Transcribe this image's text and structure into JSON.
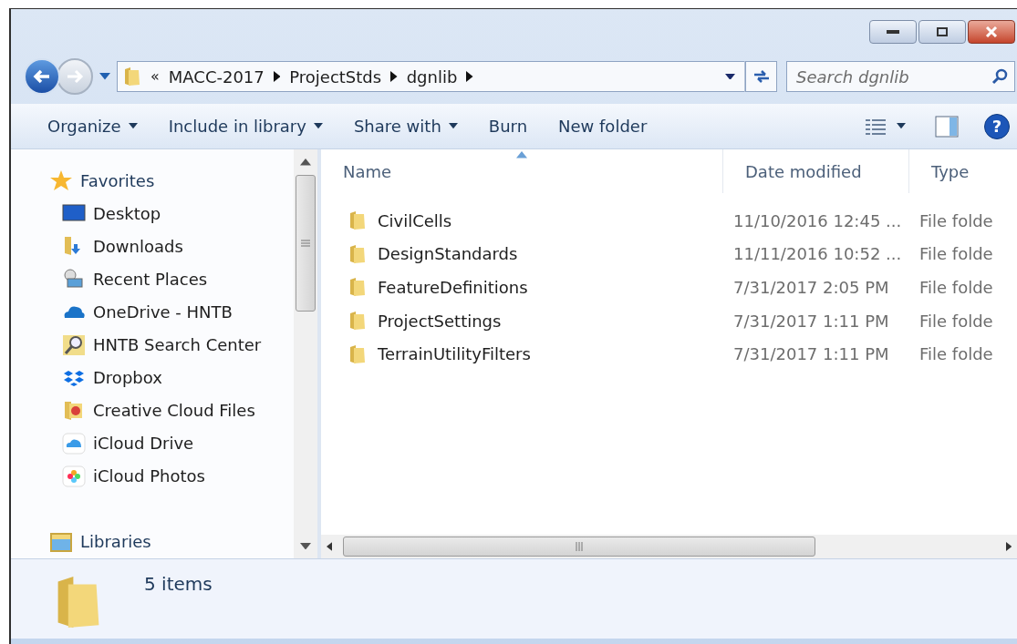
{
  "address_bar": {
    "overflow_mark": "«",
    "segments": [
      "MACC-2017",
      "ProjectStds",
      "dgnlib"
    ]
  },
  "search": {
    "placeholder": "Search dgnlib"
  },
  "toolbar": [
    {
      "label": "Organize",
      "dropdown": true
    },
    {
      "label": "Include in library",
      "dropdown": true
    },
    {
      "label": "Share with",
      "dropdown": true
    },
    {
      "label": "Burn",
      "dropdown": false
    },
    {
      "label": "New folder",
      "dropdown": false
    }
  ],
  "sidebar": {
    "items": [
      {
        "label": "Favorites",
        "kind": "star",
        "header": true
      },
      {
        "label": "Desktop",
        "kind": "desktop",
        "header": false
      },
      {
        "label": "Downloads",
        "kind": "downloads",
        "header": false
      },
      {
        "label": "Recent Places",
        "kind": "recent",
        "header": false
      },
      {
        "label": "OneDrive - HNTB",
        "kind": "onedrive",
        "header": false
      },
      {
        "label": "HNTB Search Center",
        "kind": "searchcenter",
        "header": false
      },
      {
        "label": "Dropbox",
        "kind": "dropbox",
        "header": false
      },
      {
        "label": "Creative Cloud Files",
        "kind": "creative",
        "header": false
      },
      {
        "label": "iCloud Drive",
        "kind": "icloud",
        "header": false
      },
      {
        "label": "iCloud Photos",
        "kind": "photos",
        "header": false
      },
      {
        "label": "Libraries",
        "kind": "libraries",
        "header": true
      }
    ]
  },
  "table": {
    "columns": [
      {
        "label": "Name",
        "sorted": true
      },
      {
        "label": "Date modified",
        "sorted": false
      },
      {
        "label": "Type",
        "sorted": false
      }
    ],
    "rows": [
      {
        "name": "CivilCells",
        "date": "11/10/2016 12:45 ...",
        "type": "File folde"
      },
      {
        "name": "DesignStandards",
        "date": "11/11/2016 10:52 ...",
        "type": "File folde"
      },
      {
        "name": "FeatureDefinitions",
        "date": "7/31/2017 2:05 PM",
        "type": "File folde"
      },
      {
        "name": "ProjectSettings",
        "date": "7/31/2017 1:11 PM",
        "type": "File folde"
      },
      {
        "name": "TerrainUtilityFilters",
        "date": "7/31/2017 1:11 PM",
        "type": "File folde"
      }
    ]
  },
  "help_button": {
    "label": "?"
  },
  "status_bar": {
    "text": "5 items"
  }
}
